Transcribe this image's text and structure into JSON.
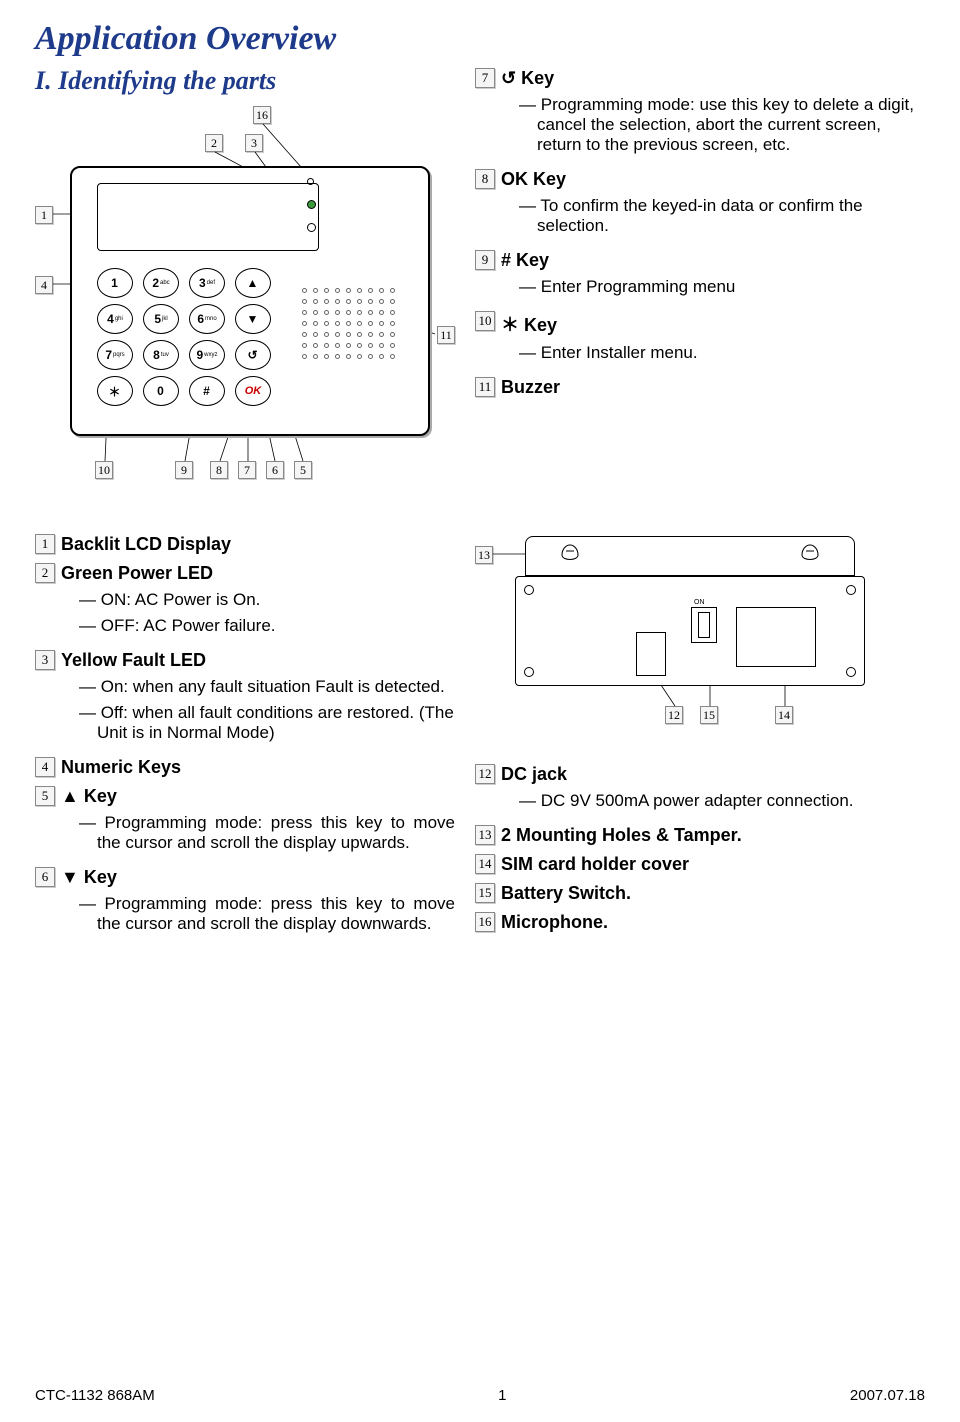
{
  "page_title": "Application Overview",
  "section": "I. Identifying the parts",
  "callouts_fig1": {
    "top_left_a": "2",
    "top_left_b": "3",
    "top_right": "16",
    "left_a": "1",
    "left_b": "4",
    "right": "11",
    "bottom": [
      "10",
      "9",
      "8",
      "7",
      "6",
      "5"
    ]
  },
  "callouts_fig2": {
    "left": "13",
    "bottom": [
      "12",
      "15",
      "14"
    ]
  },
  "items_right_top": [
    {
      "n": "7",
      "title": "↺ Key",
      "subs": [
        "Programming mode: use this key to delete a digit, cancel the selection, abort the current screen, return to the previous screen, etc."
      ]
    },
    {
      "n": "8",
      "title": "OK  Key",
      "subs": [
        "To confirm the keyed-in data or confirm the selection."
      ]
    },
    {
      "n": "9",
      "title": "# Key",
      "subs": [
        "Enter Programming menu"
      ]
    },
    {
      "n": "10",
      "title": "＊ Key",
      "subs": [
        "Enter Installer menu."
      ]
    },
    {
      "n": "11",
      "title": "Buzzer",
      "subs": []
    }
  ],
  "items_left": [
    {
      "n": "1",
      "title": "Backlit LCD Display",
      "subs": []
    },
    {
      "n": "2",
      "title": "Green Power LED",
      "subs": [
        "ON:  AC Power is On.",
        "OFF: AC Power failure."
      ]
    },
    {
      "n": "3",
      "title": "Yellow Fault LED",
      "subs": [
        "On: when any fault situation Fault is detected.",
        "Off: when all fault conditions are restored. (The Unit is in Normal Mode)"
      ]
    },
    {
      "n": "4",
      "title": "Numeric Keys",
      "subs": []
    },
    {
      "n": "5",
      "title": "▲ Key",
      "subs": [
        "Programming mode: press this key to move the cursor and scroll the display upwards."
      ],
      "justify": true
    },
    {
      "n": "6",
      "title": "▼ Key",
      "subs": [
        "Programming mode: press this key to move the cursor and scroll the display downwards."
      ],
      "justify": true
    }
  ],
  "items_right_bottom": [
    {
      "n": "12",
      "title": "DC jack",
      "subs": [
        "DC 9V 500mA power adapter connection."
      ],
      "justify": true
    },
    {
      "n": "13",
      "title": "2 Mounting Holes & Tamper.",
      "subs": []
    },
    {
      "n": "14",
      "title": "SIM card holder cover",
      "subs": []
    },
    {
      "n": "15",
      "title": "Battery Switch.",
      "subs": []
    },
    {
      "n": "16",
      "title": "Microphone.",
      "subs": []
    }
  ],
  "keypad": [
    [
      {
        "t": "1"
      },
      {
        "t": "2",
        "s": "abc"
      },
      {
        "t": "3",
        "s": "def"
      },
      {
        "t": "▲"
      }
    ],
    [
      {
        "t": "4",
        "s": "ghi"
      },
      {
        "t": "5",
        "s": "jkl"
      },
      {
        "t": "6",
        "s": "mno"
      },
      {
        "t": "▼"
      }
    ],
    [
      {
        "t": "7",
        "s": "pqrs"
      },
      {
        "t": "8",
        "s": "tuv"
      },
      {
        "t": "9",
        "s": "wxyz"
      },
      {
        "t": "↺"
      }
    ],
    [
      {
        "t": "＊"
      },
      {
        "t": "0"
      },
      {
        "t": "#"
      },
      {
        "t": "OK",
        "ok": true
      }
    ]
  ],
  "footer": {
    "left": "CTC-1132 868AM",
    "center": "1",
    "right": "2007.07.18"
  }
}
